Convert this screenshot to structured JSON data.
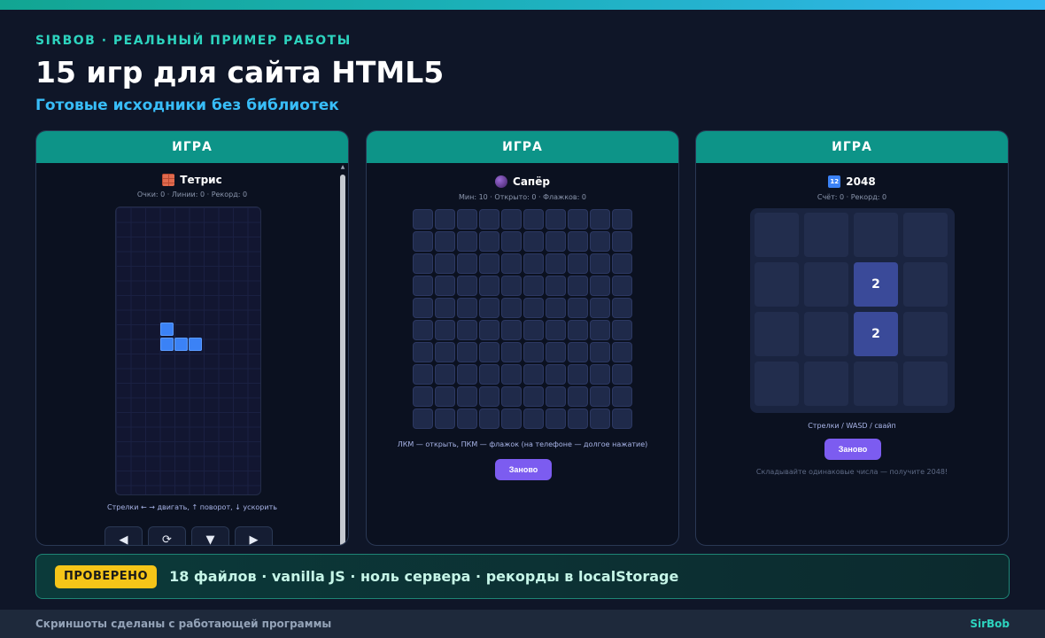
{
  "header": {
    "kicker": "SIRBOB · РЕАЛЬНЫЙ ПРИМЕР РАБОТЫ",
    "title": "15 игр для сайта HTML5",
    "subtitle": "Готовые исходники без библиотек"
  },
  "cards": [
    {
      "header": "ИГРА",
      "title": "Тетрис",
      "icon": "brick-icon",
      "stats": "Очки: 0 · Линии: 0 · Рекорд: 0",
      "hint": "Стрелки ← → двигать, ↑ поворот, ↓ ускорить",
      "controls": [
        "◀",
        "⟳",
        "▼",
        "▶"
      ]
    },
    {
      "header": "ИГРА",
      "title": "Сапёр",
      "icon": "bomb-icon",
      "stats": "Мин: 10 · Открыто: 0 · Флажков: 0",
      "hint": "ЛКМ — открыть, ПКМ — флажок (на телефоне — долгое нажатие)",
      "restart": "Заново"
    },
    {
      "header": "ИГРА",
      "title": "2048",
      "icon": "numbers-icon",
      "stats": "Счёт: 0 · Рекорд: 0",
      "hint": "Стрелки / WASD / свайп",
      "restart": "Заново",
      "tagline": "Складывайте одинаковые числа — получите 2048!",
      "tiles": [
        "",
        "",
        "",
        "",
        "",
        "",
        "2",
        "",
        "",
        "",
        "2",
        "",
        "",
        "",
        "",
        ""
      ]
    }
  ],
  "banner": {
    "badge": "ПРОВЕРЕНО",
    "text": "18 файлов · vanilla JS · ноль сервера · рекорды в localStorage"
  },
  "footer": {
    "left": "Скриншоты сделаны с работающей программы",
    "right": "SirBob"
  },
  "colors": {
    "accent": "#0d9488",
    "tetris_piece": "#3b82f6",
    "restart_button": "#7c5cf0",
    "badge": "#f5c518"
  }
}
